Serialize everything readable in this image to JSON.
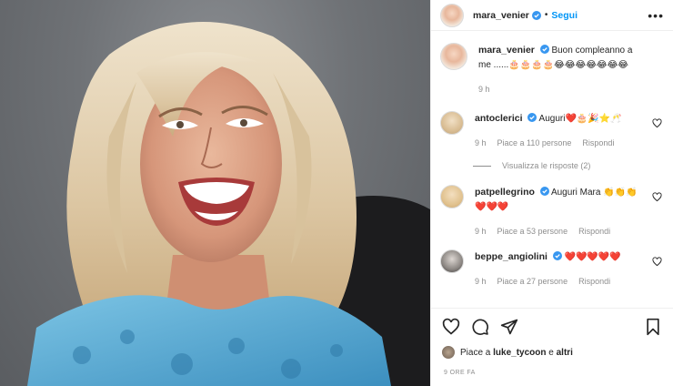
{
  "header": {
    "username": "mara_venier",
    "follow_label": "Segui",
    "more_label": "•••",
    "separator": "•"
  },
  "caption": {
    "username": "mara_venier",
    "text": "Buon compleanno a me ......🎂🎂🎂🎂😂😂😂😂😂😂😂",
    "time": "9 h"
  },
  "comments": [
    {
      "username": "antoclerici",
      "text": "Auguri❤️🎂🎉⭐🥂",
      "time": "9 h",
      "likes": "Piace a 110 persone",
      "reply": "Rispondi"
    },
    {
      "username": "patpellegrino",
      "text": "Auguri Mara 👏👏👏❤️❤️❤️",
      "time": "9 h",
      "likes": "Piace a 53 persone",
      "reply": "Rispondi"
    },
    {
      "username": "beppe_angiolini",
      "text": "❤️❤️❤️❤️❤️",
      "time": "9 h",
      "likes": "Piace a 27 persone",
      "reply": "Rispondi"
    }
  ],
  "view_replies": "Visualizza le risposte (2)",
  "likes_bar": {
    "prefix": "Piace a",
    "user": "luke_tycoon",
    "suffix": "e",
    "others": "altri"
  },
  "timestamp": "9 ORE FA",
  "icons": [
    "verified-badge-icon",
    "heart-icon",
    "comment-icon",
    "share-icon",
    "bookmark-icon",
    "more-icon"
  ],
  "colors": {
    "follow": "#0095f6",
    "verified": "#3897f0",
    "secondary_text": "#8e8e8e",
    "border": "#efefef"
  }
}
